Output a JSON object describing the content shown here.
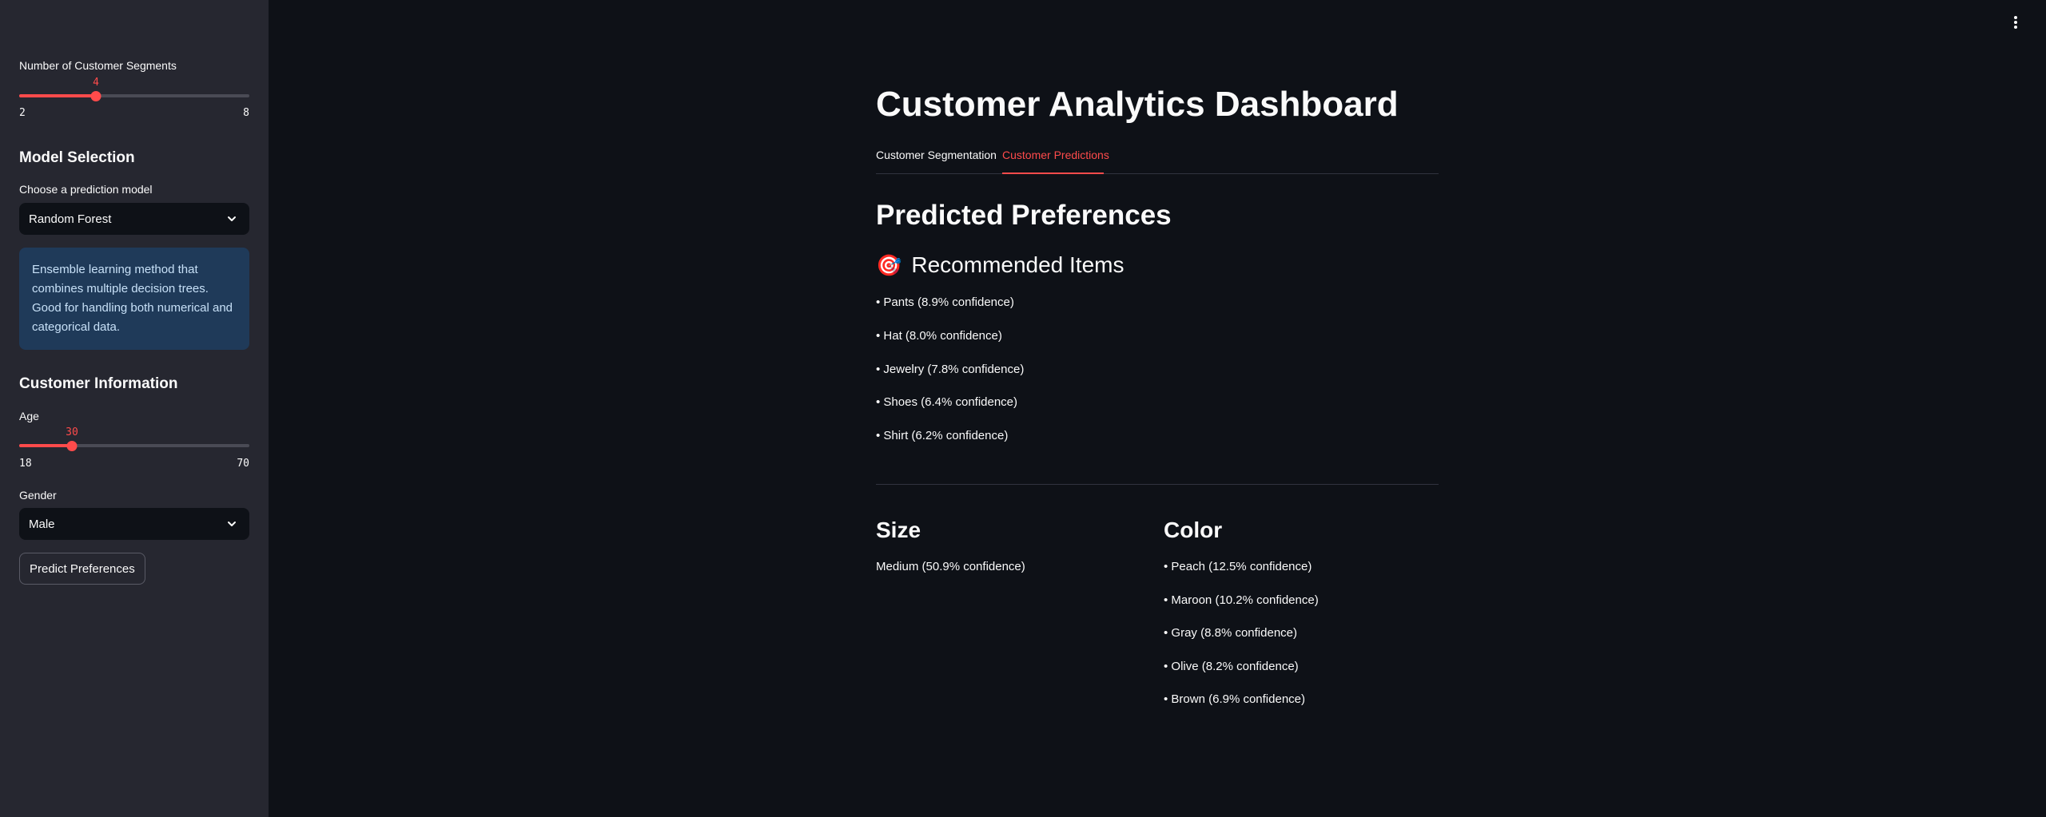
{
  "sidebar": {
    "segments": {
      "label": "Number of Customer Segments",
      "value": "4",
      "min": "2",
      "max": "8",
      "fraction": 0.333
    },
    "model_heading": "Model Selection",
    "model_label": "Choose a prediction model",
    "model_value": "Random Forest",
    "model_info": "Ensemble learning method that combines multiple decision trees. Good for handling both numerical and categorical data.",
    "customer_heading": "Customer Information",
    "age": {
      "label": "Age",
      "value": "30",
      "min": "18",
      "max": "70",
      "fraction": 0.231
    },
    "gender_label": "Gender",
    "gender_value": "Male",
    "predict_button": "Predict Preferences"
  },
  "main": {
    "title": "Customer Analytics Dashboard",
    "tabs": [
      {
        "label": "Customer Segmentation",
        "active": false
      },
      {
        "label": "Customer Predictions",
        "active": true
      }
    ],
    "section_title": "Predicted Preferences",
    "recommended": {
      "icon": "🎯",
      "heading": "Recommended Items",
      "items": [
        "• Pants (8.9% confidence)",
        "• Hat (8.0% confidence)",
        "• Jewelry (7.8% confidence)",
        "• Shoes (6.4% confidence)",
        "• Shirt (6.2% confidence)"
      ]
    },
    "size": {
      "heading": "Size",
      "value": "Medium (50.9% confidence)"
    },
    "color": {
      "heading": "Color",
      "items": [
        "• Peach (12.5% confidence)",
        "• Maroon (10.2% confidence)",
        "• Gray (8.8% confidence)",
        "• Olive (8.2% confidence)",
        "• Brown (6.9% confidence)"
      ]
    }
  },
  "colors": {
    "accent": "#ff4b4b",
    "background": "#0e1117",
    "sidebar": "#262730",
    "info_bg": "#1f3a59"
  }
}
